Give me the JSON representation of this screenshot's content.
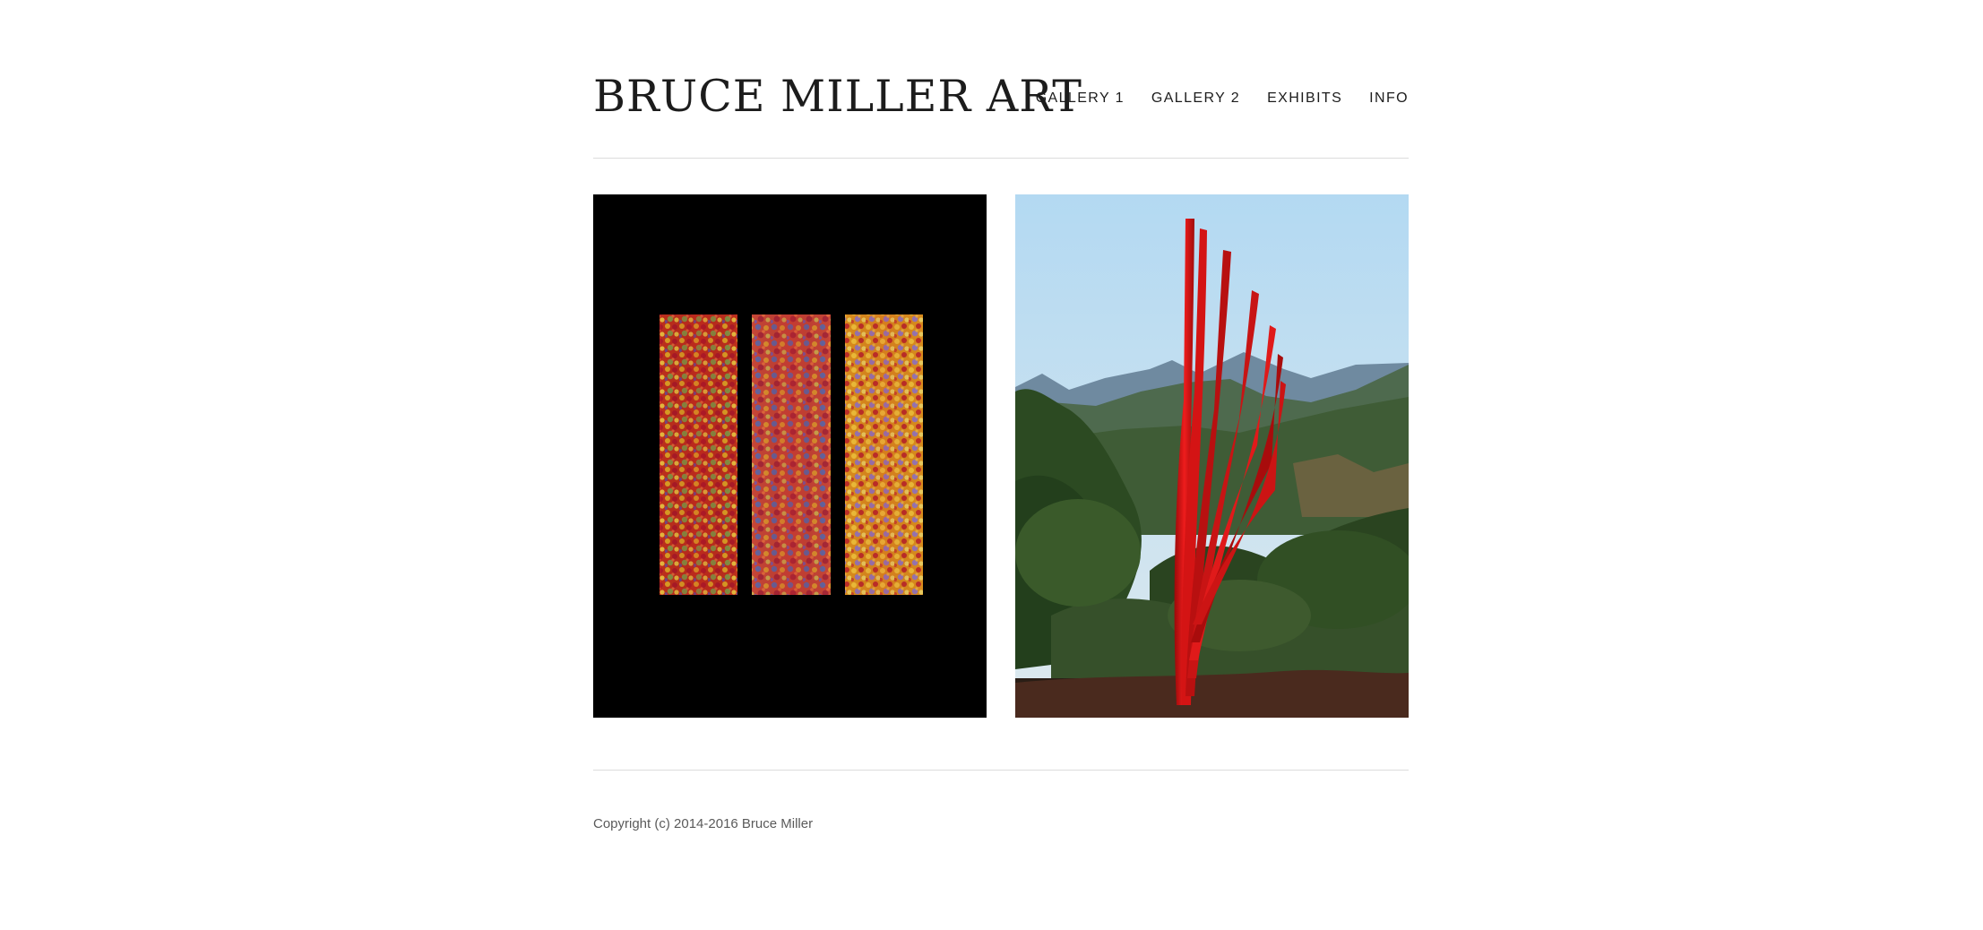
{
  "site": {
    "title": "BRUCE MILLER ART"
  },
  "nav": {
    "items": [
      {
        "label": "GALLERY 1"
      },
      {
        "label": "GALLERY 2"
      },
      {
        "label": "EXHIBITS"
      },
      {
        "label": "INFO"
      }
    ]
  },
  "gallery": {
    "images": [
      {
        "name": "triptych-painting",
        "background": "#000000"
      },
      {
        "name": "red-sculpture-landscape",
        "accent": "#d81414"
      }
    ]
  },
  "footer": {
    "copyright": "Copyright (c) 2014-2016 Bruce Miller"
  },
  "colors": {
    "text": "#1c1c1c",
    "rule": "#dcdcdc",
    "footer_text": "#5a5a5a"
  }
}
